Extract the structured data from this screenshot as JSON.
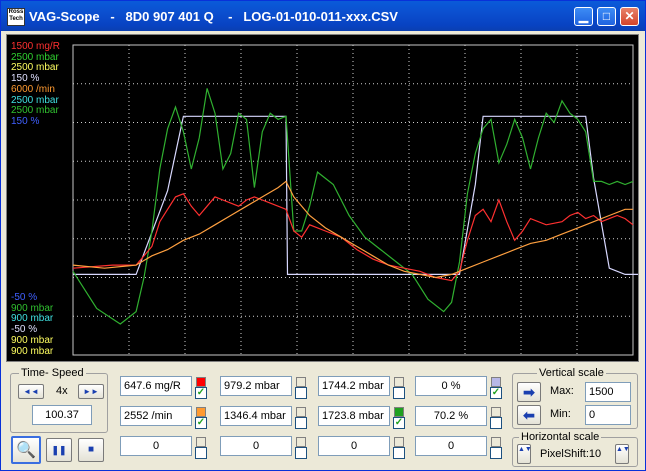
{
  "window": {
    "title": "VAG-Scope   -   8D0 907 401 Q    -   LOG-01-010-011-xxx.CSV",
    "app_icon_text": "Ross Tech",
    "min_glyph": "▁",
    "max_glyph": "□",
    "close_glyph": "✕"
  },
  "scope": {
    "top_labels": [
      {
        "text": "1500 mg/R",
        "color": "#ff3030"
      },
      {
        "text": "2500 mbar",
        "color": "#30d030"
      },
      {
        "text": "2500 mbar",
        "color": "#ffff60"
      },
      {
        "text": "150 %",
        "color": "#e0e0ff"
      },
      {
        "text": "6000 /min",
        "color": "#ff9a30"
      },
      {
        "text": "2500 mbar",
        "color": "#40e0e0"
      },
      {
        "text": "2500 mbar",
        "color": "#30c030"
      },
      {
        "text": "150 %",
        "color": "#4060ff"
      }
    ],
    "bottom_labels": [
      {
        "text": "-50 %",
        "color": "#4060ff"
      },
      {
        "text": "900 mbar",
        "color": "#30c030"
      },
      {
        "text": "900 mbar",
        "color": "#40e0e0"
      },
      {
        "text": "-50 %",
        "color": "#e0e0ff"
      },
      {
        "text": "900 mbar",
        "color": "#ffff60"
      },
      {
        "text": "900 mbar",
        "color": "#ffff60"
      }
    ],
    "traces": {
      "lavender": [
        [
          0,
          74
        ],
        [
          8,
          74
        ],
        [
          12,
          47
        ],
        [
          14,
          23
        ],
        [
          27,
          23
        ],
        [
          27.2,
          74
        ],
        [
          49,
          74
        ],
        [
          51,
          45
        ],
        [
          52,
          23
        ],
        [
          65,
          23
        ],
        [
          66,
          43
        ],
        [
          68,
          72
        ],
        [
          70,
          74
        ],
        [
          100,
          74
        ]
      ],
      "green": [
        [
          0,
          73
        ],
        [
          3,
          85
        ],
        [
          6,
          90
        ],
        [
          8,
          86
        ],
        [
          9,
          75
        ],
        [
          10,
          60
        ],
        [
          11,
          40
        ],
        [
          12,
          27
        ],
        [
          13,
          20
        ],
        [
          14,
          28
        ],
        [
          15,
          40
        ],
        [
          16,
          30
        ],
        [
          17,
          14
        ],
        [
          18,
          22
        ],
        [
          19,
          40
        ],
        [
          20,
          35
        ],
        [
          21,
          22
        ],
        [
          22,
          24
        ],
        [
          23,
          46
        ],
        [
          24,
          28
        ],
        [
          25,
          22
        ],
        [
          26,
          24
        ],
        [
          27,
          23
        ],
        [
          28,
          60
        ],
        [
          29,
          60
        ],
        [
          30,
          52
        ],
        [
          31,
          41
        ],
        [
          33,
          45
        ],
        [
          35,
          55
        ],
        [
          37,
          62
        ],
        [
          39,
          66
        ],
        [
          41,
          70
        ],
        [
          43,
          74
        ],
        [
          45,
          82
        ],
        [
          47,
          86
        ],
        [
          48,
          83
        ],
        [
          49,
          70
        ],
        [
          50,
          48
        ],
        [
          51,
          35
        ],
        [
          52,
          27
        ],
        [
          53,
          24
        ],
        [
          54,
          38
        ],
        [
          55,
          32
        ],
        [
          56,
          24
        ],
        [
          57,
          30
        ],
        [
          58,
          40
        ],
        [
          59,
          30
        ],
        [
          60,
          22
        ],
        [
          61,
          25
        ],
        [
          62,
          18
        ],
        [
          63,
          22
        ],
        [
          64,
          24
        ],
        [
          65,
          28
        ],
        [
          66,
          44
        ],
        [
          67,
          44
        ],
        [
          68,
          45
        ],
        [
          69,
          44
        ],
        [
          70,
          45
        ],
        [
          71,
          44
        ]
      ],
      "red": [
        [
          0,
          72
        ],
        [
          5,
          71
        ],
        [
          8,
          71
        ],
        [
          10,
          65
        ],
        [
          11,
          57
        ],
        [
          12,
          53
        ],
        [
          13,
          49
        ],
        [
          14,
          48
        ],
        [
          15,
          52
        ],
        [
          16,
          55
        ],
        [
          17,
          52
        ],
        [
          18,
          49
        ],
        [
          19,
          50
        ],
        [
          20,
          51
        ],
        [
          21,
          52
        ],
        [
          22,
          50
        ],
        [
          23,
          49
        ],
        [
          24,
          50
        ],
        [
          25,
          51
        ],
        [
          26,
          52
        ],
        [
          27,
          53
        ],
        [
          28,
          60
        ],
        [
          29,
          62
        ],
        [
          30,
          58
        ],
        [
          32,
          60
        ],
        [
          34,
          62
        ],
        [
          36,
          66
        ],
        [
          38,
          69
        ],
        [
          40,
          71
        ],
        [
          42,
          72
        ],
        [
          44,
          73
        ],
        [
          46,
          75
        ],
        [
          48,
          76
        ],
        [
          49,
          73
        ],
        [
          50,
          63
        ],
        [
          51,
          55
        ],
        [
          52,
          53
        ],
        [
          53,
          57
        ],
        [
          54,
          50
        ],
        [
          55,
          57
        ],
        [
          56,
          63
        ],
        [
          57,
          60
        ],
        [
          58,
          56
        ],
        [
          60,
          58
        ],
        [
          62,
          57
        ],
        [
          63,
          55
        ],
        [
          64,
          54
        ],
        [
          65,
          56
        ],
        [
          66,
          55
        ],
        [
          67,
          57
        ],
        [
          68,
          56
        ],
        [
          69,
          55
        ],
        [
          70,
          56
        ],
        [
          71,
          58
        ]
      ],
      "orange": [
        [
          0,
          71
        ],
        [
          4,
          72
        ],
        [
          8,
          71
        ],
        [
          10,
          68
        ],
        [
          12,
          66
        ],
        [
          14,
          63
        ],
        [
          16,
          61
        ],
        [
          18,
          58
        ],
        [
          20,
          55
        ],
        [
          22,
          52
        ],
        [
          24,
          49
        ],
        [
          26,
          46
        ],
        [
          27,
          44
        ],
        [
          28,
          49
        ],
        [
          30,
          55
        ],
        [
          32,
          59
        ],
        [
          34,
          62
        ],
        [
          36,
          65
        ],
        [
          38,
          68
        ],
        [
          40,
          71
        ],
        [
          42,
          73
        ],
        [
          44,
          74
        ],
        [
          46,
          75
        ],
        [
          48,
          74
        ],
        [
          50,
          72
        ],
        [
          52,
          70
        ],
        [
          54,
          68
        ],
        [
          56,
          66
        ],
        [
          58,
          64
        ],
        [
          60,
          63
        ],
        [
          62,
          61
        ],
        [
          64,
          59
        ],
        [
          66,
          57
        ],
        [
          68,
          55
        ],
        [
          70,
          53
        ],
        [
          71,
          53
        ]
      ]
    }
  },
  "time_speed": {
    "title": "Time- Speed",
    "rew_glyph": "◄◄",
    "speed": "4x",
    "fwd_glyph": "►►",
    "value": "100.37",
    "zoom_glyph": "🔍",
    "pause_glyph": "❚❚",
    "stop_glyph": "■"
  },
  "channels": {
    "row1": [
      {
        "value": "647.6 mg/R",
        "color": "#ff0000",
        "checked": true
      },
      {
        "value": "979.2 mbar",
        "color": "",
        "checked": false
      },
      {
        "value": "1744.2 mbar",
        "color": "",
        "checked": false
      },
      {
        "value": "0 %",
        "color": "#b8b8e8",
        "checked": true
      }
    ],
    "row2": [
      {
        "value": "2552 /min",
        "color": "#ff9a30",
        "checked": true
      },
      {
        "value": "1346.4 mbar",
        "color": "",
        "checked": false
      },
      {
        "value": "1723.8 mbar",
        "color": "#20a020",
        "checked": true
      },
      {
        "value": "70.2 %",
        "color": "",
        "checked": false
      }
    ],
    "row3": [
      {
        "value": "0",
        "color": "",
        "checked": false
      },
      {
        "value": "0",
        "color": "",
        "checked": false
      },
      {
        "value": "0",
        "color": "",
        "checked": false
      },
      {
        "value": "0",
        "color": "",
        "checked": false
      }
    ]
  },
  "vertical_scale": {
    "title": "Vertical scale",
    "max_label": "Max:",
    "max_value": "1500",
    "min_label": "Min:",
    "min_value": "0",
    "right_arrow": "➡",
    "left_arrow": "⬅"
  },
  "horizontal_scale": {
    "title": "Horizontal scale",
    "pixel_shift": "PixelShift:10",
    "arrow": "▲▼"
  }
}
